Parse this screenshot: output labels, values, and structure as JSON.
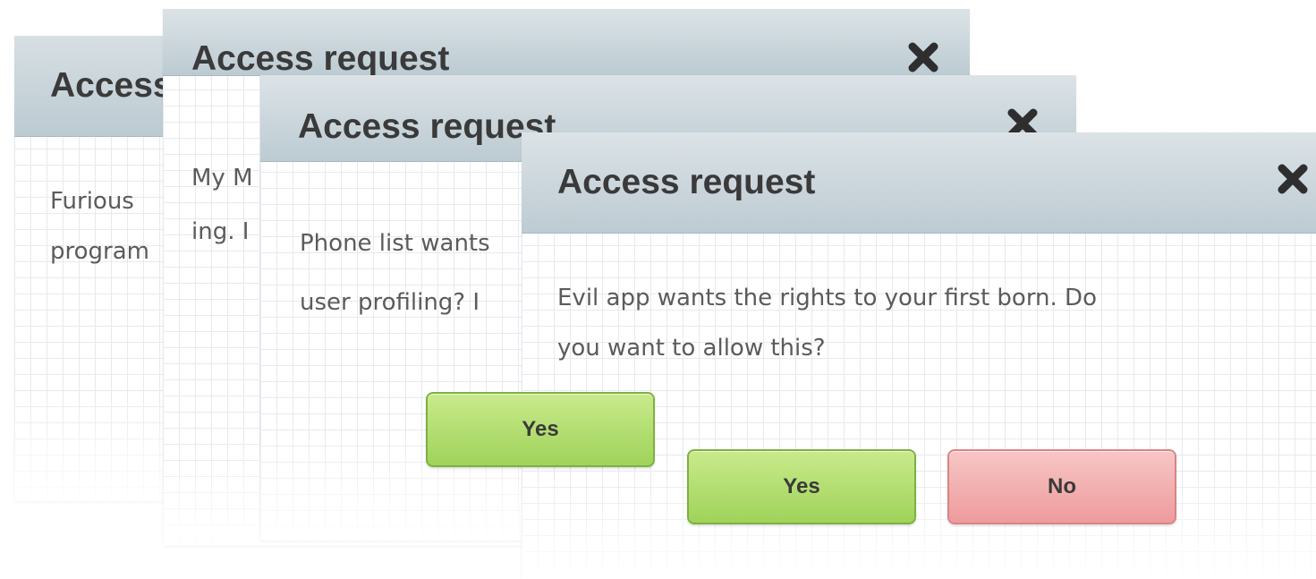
{
  "dialogs": [
    {
      "title": "Access request",
      "message_lines": [
        "Furious",
        "program"
      ]
    },
    {
      "title": "Access request",
      "message_lines": [
        "My M",
        "ing. I"
      ]
    },
    {
      "title": "Access request",
      "message_lines": [
        "Phone list wants",
        "user profiling? I"
      ],
      "yes_label": "Yes"
    },
    {
      "title": "Access request",
      "message_lines": [
        "Evil app wants the rights to your first born. Do",
        "you want to allow this?"
      ],
      "yes_label": "Yes",
      "no_label": "No"
    }
  ],
  "icons": {
    "close": "close-icon"
  },
  "colors": {
    "titlebar": "#c4d1d7",
    "yes_button": "#a8d865",
    "no_button": "#f2aaab",
    "title_text": "#3a3a3a",
    "body_text": "#5b5b5b"
  }
}
